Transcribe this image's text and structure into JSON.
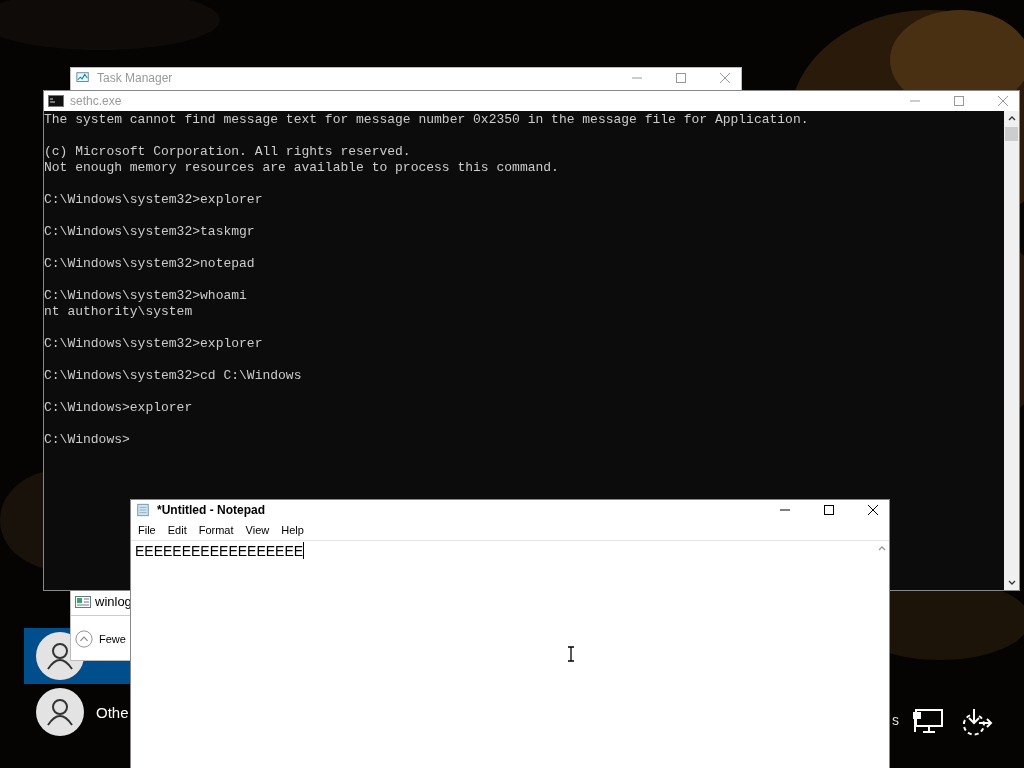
{
  "login": {
    "users": [
      {
        "selected": true
      },
      {
        "name": "Othe",
        "selected": false
      }
    ],
    "corner_text": "s"
  },
  "task_manager": {
    "title": "Task Manager",
    "process_row": "winlog",
    "details_button": "Fewe"
  },
  "console": {
    "title": "sethc.exe",
    "blocks": [
      [
        "The system cannot find message text for message number 0x2350 in the message file for Application."
      ],
      [
        "(c) Microsoft Corporation. All rights reserved.",
        "Not enough memory resources are available to process this command."
      ],
      [
        "C:\\Windows\\system32>explorer"
      ],
      [
        "C:\\Windows\\system32>taskmgr"
      ],
      [
        "C:\\Windows\\system32>notepad"
      ],
      [
        "C:\\Windows\\system32>whoami",
        "nt authority\\system"
      ],
      [
        "C:\\Windows\\system32>explorer"
      ],
      [
        "C:\\Windows\\system32>cd C:\\Windows"
      ],
      [
        "C:\\Windows>explorer"
      ],
      [
        "C:\\Windows>"
      ]
    ]
  },
  "notepad": {
    "title": "*Untitled - Notepad",
    "menus": [
      "File",
      "Edit",
      "Format",
      "View",
      "Help"
    ],
    "text": "EEEEEEEEEEEEEEEEEE"
  }
}
